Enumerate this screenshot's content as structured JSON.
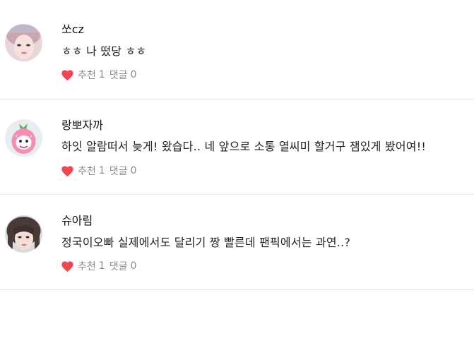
{
  "comments": [
    {
      "author": "쏘cz",
      "text": "ㅎㅎ 나 떴당 ㅎㅎ",
      "like_label": "추천",
      "like_count": "1",
      "reply_label": "댓글",
      "reply_count": "0"
    },
    {
      "author": "랑뽀자까",
      "text": "하잇 알람떠서 늦게! 왔습다.. 네 앞으로 소통 열씨미 할거구 잼있게 봤어여!!",
      "like_label": "추천",
      "like_count": "1",
      "reply_label": "댓글",
      "reply_count": "0"
    },
    {
      "author": "슈아림",
      "text": "정국이오빠 실제에서도 달리기 짱 빨른데 팬픽에서는 과연..?",
      "like_label": "추천",
      "like_count": "1",
      "reply_label": "댓글",
      "reply_count": "0"
    }
  ],
  "colors": {
    "heart": "#f0464d",
    "meta_text": "#8a8a8a",
    "divider": "#e8e8e8"
  },
  "icons": {
    "like": "heart-icon",
    "avatar": "avatar"
  }
}
